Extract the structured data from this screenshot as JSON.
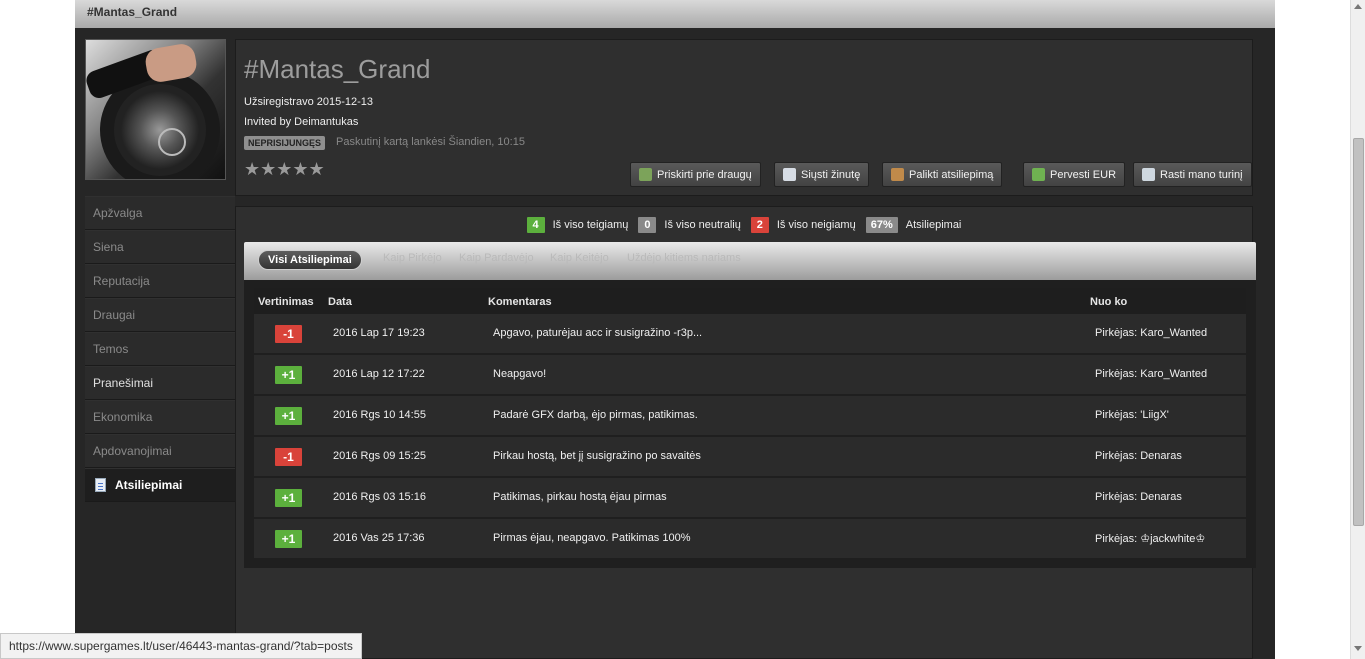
{
  "window": {
    "title": "#Mantas_Grand"
  },
  "profile": {
    "name": "#Mantas_Grand",
    "registered": "Užsiregistravo 2015-12-13",
    "invited": "Invited by Deimantukas",
    "status_badge": "NEPRISIJUNGĘS",
    "last_visit": "Paskutinį kartą lankėsi Šiandien, 10:15",
    "stars": "★★★★★"
  },
  "actions": {
    "add_friend": "Priskirti prie draugų",
    "send_message": "Siųsti žinutę",
    "leave_feedback": "Palikti atsiliepimą",
    "transfer": "Pervesti EUR",
    "find_content": "Rasti mano turinį"
  },
  "sidebar": {
    "items": [
      {
        "label": "Apžvalga"
      },
      {
        "label": "Siena"
      },
      {
        "label": "Reputacija"
      },
      {
        "label": "Draugai"
      },
      {
        "label": "Temos"
      },
      {
        "label": "Pranešimai"
      },
      {
        "label": "Ekonomika"
      },
      {
        "label": "Apdovanojimai"
      },
      {
        "label": "Atsiliepimai"
      }
    ]
  },
  "summary": {
    "positive_count": "4",
    "positive_label": "Iš viso teigiamų",
    "neutral_count": "0",
    "neutral_label": "Iš viso neutralių",
    "negative_count": "2",
    "negative_label": "Iš viso neigiamų",
    "percent": "67%",
    "percent_label": "Atsiliepimai"
  },
  "tabs": {
    "all": "Visi Atsiliepimai",
    "buyer": "Kaip Pirkėjo",
    "seller": "Kaip Pardavėjo",
    "exchanger": "Kaip Keitėjo",
    "given": "Uždėjo kitiems nariams"
  },
  "table": {
    "headers": {
      "rating": "Vertinimas",
      "date": "Data",
      "comment": "Komentaras",
      "from": "Nuo ko"
    },
    "rows": [
      {
        "rating": "-1",
        "date": "2016 Lap 17 19:23",
        "comment": "Apgavo, paturėjau acc ir susigražino -r3p...",
        "from": "Pirkėjas: Karo_Wanted"
      },
      {
        "rating": "+1",
        "date": "2016 Lap 12 17:22",
        "comment": "Neapgavo!",
        "from": "Pirkėjas: Karo_Wanted"
      },
      {
        "rating": "+1",
        "date": "2016 Rgs 10 14:55",
        "comment": "Padarė GFX darbą, ėjo pirmas, patikimas.",
        "from": "Pirkėjas: 'LiigX'"
      },
      {
        "rating": "-1",
        "date": "2016 Rgs 09 15:25",
        "comment": "Pirkau hostą, bet jį susigražino po savaitės",
        "from": "Pirkėjas: Denaras"
      },
      {
        "rating": "+1",
        "date": "2016 Rgs 03 15:16",
        "comment": "Patikimas, pirkau hostą ėjau pirmas",
        "from": "Pirkėjas: Denaras"
      },
      {
        "rating": "+1",
        "date": "2016 Vas 25 17:36",
        "comment": "Pirmas ėjau, neapgavo. Patikimas 100%",
        "from": "Pirkėjas: ♔jackwhite♔"
      }
    ]
  },
  "status_url": "https://www.supergames.lt/user/46443-mantas-grand/?tab=posts",
  "colors": {
    "positive": "#5cb03d",
    "negative": "#d9433a",
    "neutral": "#8a8a8a",
    "percent": "#8a8a8a"
  }
}
